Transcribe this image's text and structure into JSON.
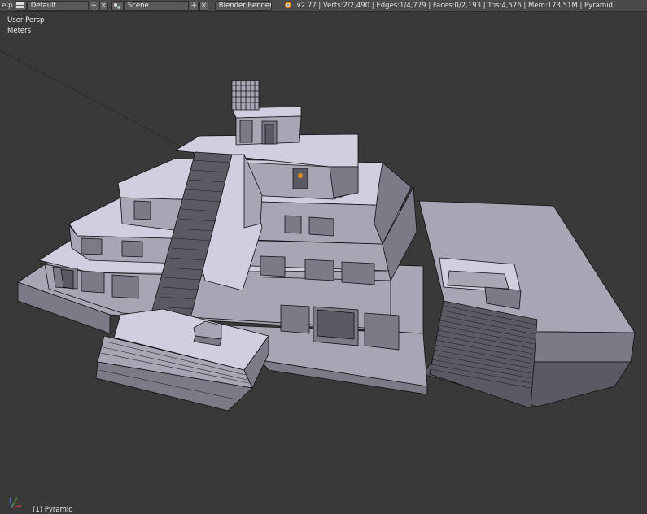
{
  "header": {
    "menu_tail": "elp",
    "screen_layout": "Default",
    "scene": "Scene",
    "render_engine": "Blender Render",
    "stats": "v2.77 | Verts:2/2,490 | Edges:1/4,779 | Faces:0/2,193 | Tris:4,576 | Mem:173.51M | Pyramid",
    "add_symbol": "+",
    "close_symbol": "×"
  },
  "viewport": {
    "view_name": "User Persp",
    "units": "Meters",
    "selected_object": "(1) Pyramid"
  },
  "colors": {
    "header_bg": "#4a4a4a",
    "viewport_bg": "#393939",
    "mesh_face": "#a6a6b4",
    "accent_orange": "#e08a1e"
  }
}
